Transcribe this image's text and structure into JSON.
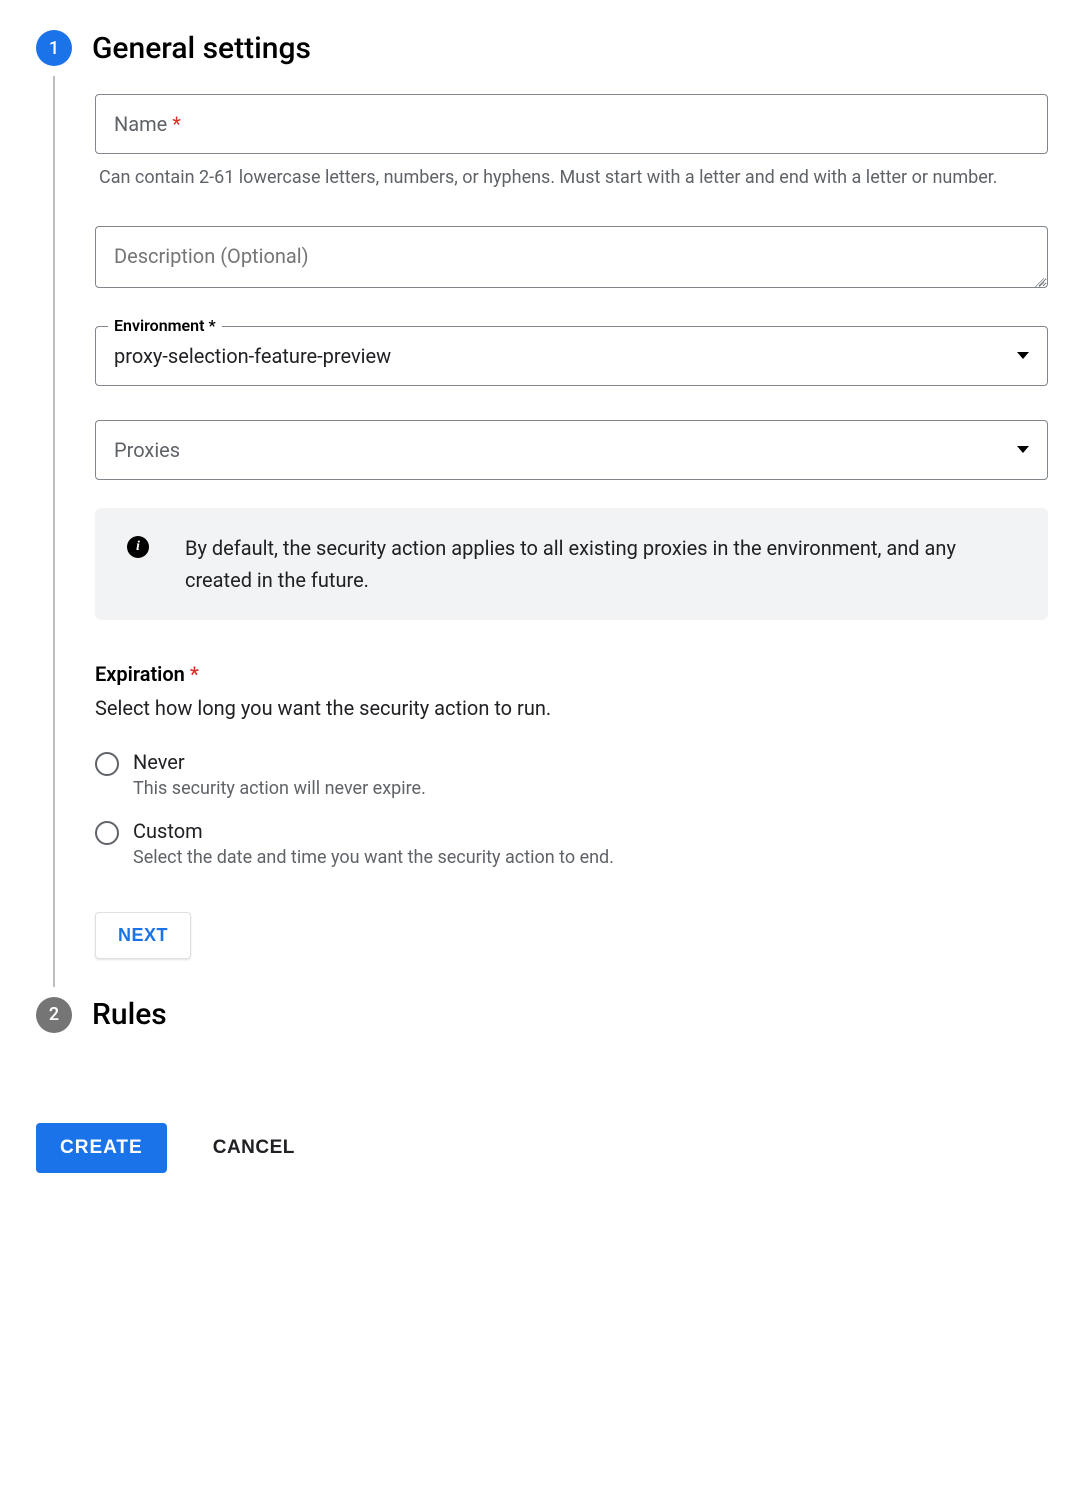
{
  "steps": {
    "step1": {
      "number": "1",
      "title": "General settings"
    },
    "step2": {
      "number": "2",
      "title": "Rules"
    }
  },
  "name_field": {
    "label": "Name",
    "required_marker": "*",
    "value": "",
    "helper": "Can contain 2-61 lowercase letters, numbers, or hyphens. Must start with a letter and end with a letter or number."
  },
  "description_field": {
    "placeholder": "Description (Optional)",
    "value": ""
  },
  "environment_field": {
    "label": "Environment *",
    "value": "proxy-selection-feature-preview"
  },
  "proxies_field": {
    "placeholder": "Proxies",
    "value": ""
  },
  "info_banner": {
    "text": "By default, the security action applies to all existing proxies in the environment, and any created in the future."
  },
  "expiration": {
    "label": "Expiration",
    "required_marker": "*",
    "subtext": "Select how long you want the security action to run.",
    "options": {
      "never": {
        "title": "Never",
        "desc": "This security action will never expire."
      },
      "custom": {
        "title": "Custom",
        "desc": "Select the date and time you want the security action to end."
      }
    }
  },
  "buttons": {
    "next": "NEXT",
    "create": "CREATE",
    "cancel": "CANCEL"
  }
}
